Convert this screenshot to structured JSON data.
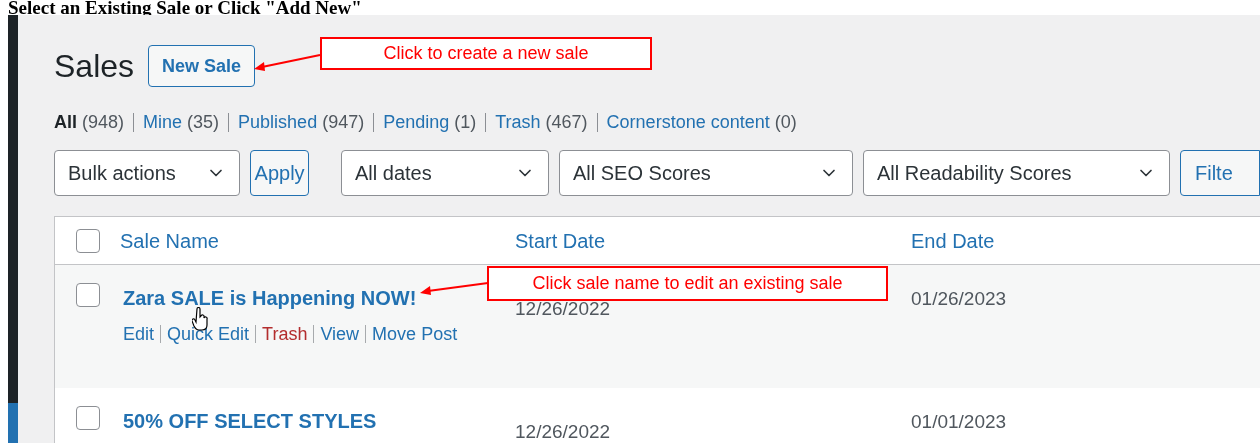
{
  "heading": "Select an Existing Sale or Click \"Add New\"",
  "page_title": "Sales",
  "new_button": "New Sale",
  "filters": [
    {
      "label": "All",
      "count": "(948)",
      "selected": true
    },
    {
      "label": "Mine",
      "count": "(35)",
      "selected": false
    },
    {
      "label": "Published",
      "count": "(947)",
      "selected": false
    },
    {
      "label": "Pending",
      "count": "(1)",
      "selected": false
    },
    {
      "label": "Trash",
      "count": "(467)",
      "selected": false
    },
    {
      "label": "Cornerstone content",
      "count": "(0)",
      "selected": false
    }
  ],
  "bulk_actions": "Bulk actions",
  "apply_button": "Apply",
  "dropdowns": [
    "All dates",
    "All SEO Scores",
    "All Readability Scores"
  ],
  "filter_button": "Filte",
  "table": {
    "select_all_checked": false,
    "columns": [
      "Sale Name",
      "Start Date",
      "End Date"
    ],
    "rows": [
      {
        "name": "Zara SALE is Happening NOW!",
        "start": "12/26/2022",
        "end": "01/26/2023",
        "hovered": true,
        "checked": false,
        "actions": [
          {
            "label": "Edit",
            "kind": "normal"
          },
          {
            "label": "Quick Edit",
            "kind": "normal"
          },
          {
            "label": "Trash",
            "kind": "danger"
          },
          {
            "label": "View",
            "kind": "normal"
          },
          {
            "label": "Move Post",
            "kind": "normal"
          }
        ]
      },
      {
        "name": "50% OFF SELECT STYLES",
        "start": "12/26/2022",
        "end": "01/01/2023",
        "hovered": false,
        "checked": false,
        "actions": []
      }
    ]
  },
  "callouts": [
    "Click to create a new sale",
    "Click sale name to edit an existing sale"
  ]
}
